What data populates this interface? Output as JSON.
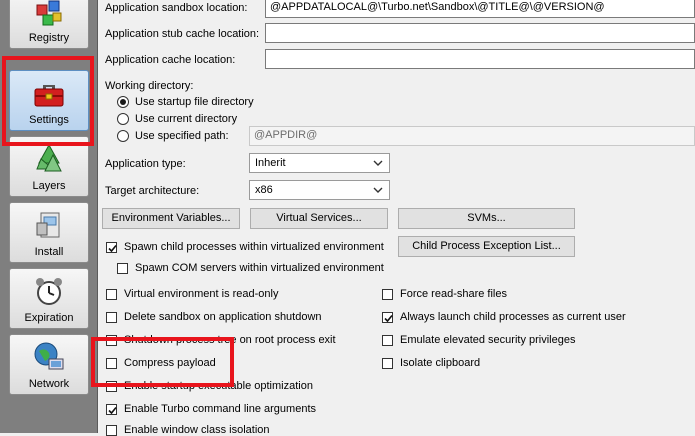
{
  "sidebar": {
    "items": [
      {
        "label": "Registry",
        "icon": "registry-icon"
      },
      {
        "label": "Settings",
        "icon": "toolbox-icon",
        "selected": true
      },
      {
        "label": "Layers",
        "icon": "layers-icon"
      },
      {
        "label": "Install",
        "icon": "install-icon"
      },
      {
        "label": "Expiration",
        "icon": "alarm-clock-icon"
      },
      {
        "label": "Network",
        "icon": "globe-icon"
      }
    ]
  },
  "settings": {
    "sandbox_location_label": "Application sandbox location:",
    "sandbox_location_value": "@APPDATALOCAL@\\Turbo.net\\Sandbox\\@TITLE@\\@VERSION@",
    "stub_cache_label": "Application stub cache location:",
    "stub_cache_value": "",
    "app_cache_label": "Application cache location:",
    "app_cache_value": "",
    "working_dir_label": "Working directory:",
    "working_dir_options": [
      "Use startup file directory",
      "Use current directory",
      "Use specified path:"
    ],
    "working_dir_selected": 0,
    "specified_path_value": "@APPDIR@",
    "app_type_label": "Application type:",
    "app_type_value": "Inherit",
    "target_arch_label": "Target architecture:",
    "target_arch_value": "x86",
    "buttons": {
      "env_vars": "Environment Variables...",
      "virtual_services": "Virtual Services...",
      "svms": "SVMs...",
      "child_exception": "Child Process Exception List..."
    },
    "checkboxes": {
      "spawn_child": {
        "label": "Spawn child processes within virtualized environment",
        "checked": true
      },
      "spawn_com": {
        "label": "Spawn COM servers within virtualized environment",
        "checked": false
      },
      "read_only": {
        "label": "Virtual environment is read-only",
        "checked": false
      },
      "delete_sandbox": {
        "label": "Delete sandbox on application shutdown",
        "checked": false
      },
      "shutdown_tree": {
        "label": "Shutdown process tree on root process exit",
        "checked": false
      },
      "compress": {
        "label": "Compress payload",
        "checked": false
      },
      "startup_opt": {
        "label": "Enable startup executable optimization",
        "checked": false
      },
      "cmdline_args": {
        "label": "Enable Turbo command line arguments",
        "checked": true
      },
      "window_class": {
        "label": "Enable window class isolation",
        "checked": false
      },
      "force_share": {
        "label": "Force read-share files",
        "checked": false
      },
      "launch_current_user": {
        "label": "Always launch child processes as current user",
        "checked": true
      },
      "emulate_elevated": {
        "label": "Emulate elevated security privileges",
        "checked": false
      },
      "isolate_clipboard": {
        "label": "Isolate clipboard",
        "checked": false
      }
    }
  },
  "colors": {
    "highlight": "#e8141c",
    "sidebar_bg": "#7f7f7f"
  }
}
